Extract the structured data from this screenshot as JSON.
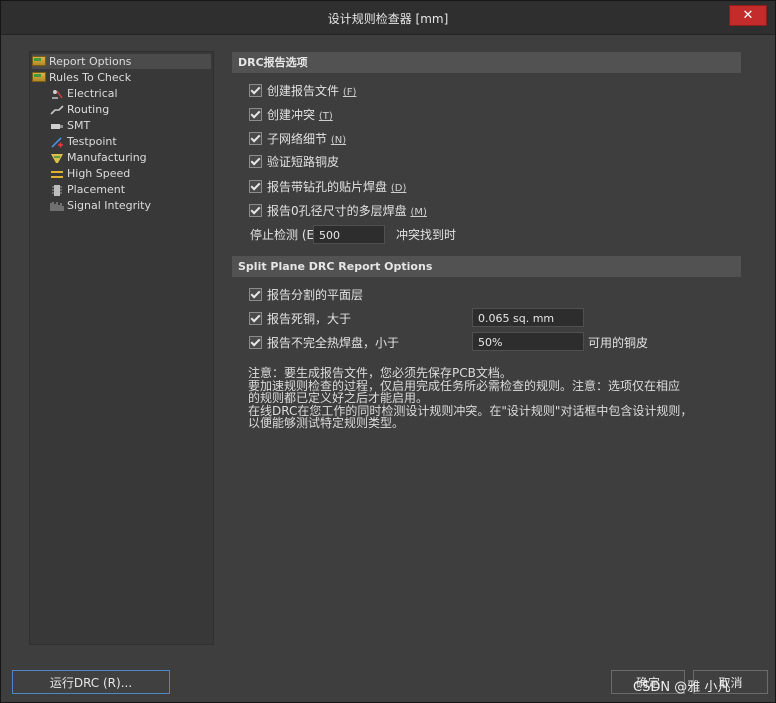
{
  "window": {
    "title": "设计规则检查器 [mm]",
    "close_label": "✕"
  },
  "tree": {
    "items": [
      {
        "label": "Report Options",
        "icon": "folder-report-icon"
      },
      {
        "label": "Rules To Check",
        "icon": "folder-rules-icon"
      },
      {
        "label": "Electrical",
        "icon": "electrical-icon"
      },
      {
        "label": "Routing",
        "icon": "routing-icon"
      },
      {
        "label": "SMT",
        "icon": "smt-icon"
      },
      {
        "label": "Testpoint",
        "icon": "testpoint-icon"
      },
      {
        "label": "Manufacturing",
        "icon": "manufacturing-icon"
      },
      {
        "label": "High Speed",
        "icon": "high-speed-icon"
      },
      {
        "label": "Placement",
        "icon": "placement-icon"
      },
      {
        "label": "Signal Integrity",
        "icon": "signal-integrity-icon"
      }
    ]
  },
  "drc_section": {
    "header": "DRC报告选项",
    "options": [
      {
        "label": "创建报告文件",
        "shortcut": "(F)"
      },
      {
        "label": "创建冲突",
        "shortcut": "(T)"
      },
      {
        "label": "子网络细节",
        "shortcut": "(N)"
      },
      {
        "label": "验证短路铜皮",
        "shortcut": ""
      },
      {
        "label": "报告带钻孔的贴片焊盘",
        "shortcut": "(D)"
      },
      {
        "label": "报告0孔径尺寸的多层焊盘",
        "shortcut": "(M)"
      }
    ],
    "stop_label": "停止检测 (E",
    "stop_value": "500",
    "stop_suffix": "冲突找到时"
  },
  "split_section": {
    "header": "Split Plane DRC Report Options",
    "opt1": "报告分割的平面层",
    "opt2": "报告死铜，大于",
    "opt2_value": "0.065 sq. mm",
    "opt3": "报告不完全热焊盘，小于",
    "opt3_value": "50%",
    "opt3_suffix": "可用的铜皮"
  },
  "notes": [
    "注意：要生成报告文件，您必须先保存PCB文档。",
    "要加速规则检查的过程，仅启用完成任务所必需检查的规则。注意：选项仅在相应",
    "的规则都已定义好之后才能启用。",
    "在线DRC在您工作的同时检测设计规则冲突。在\"设计规则\"对话框中包含设计规则，",
    "以便能够测试特定规则类型。"
  ],
  "buttons": {
    "run": "运行DRC (R)...",
    "ok": "确定",
    "cancel": "取消"
  },
  "watermark": "CSDN @雅 小凡"
}
